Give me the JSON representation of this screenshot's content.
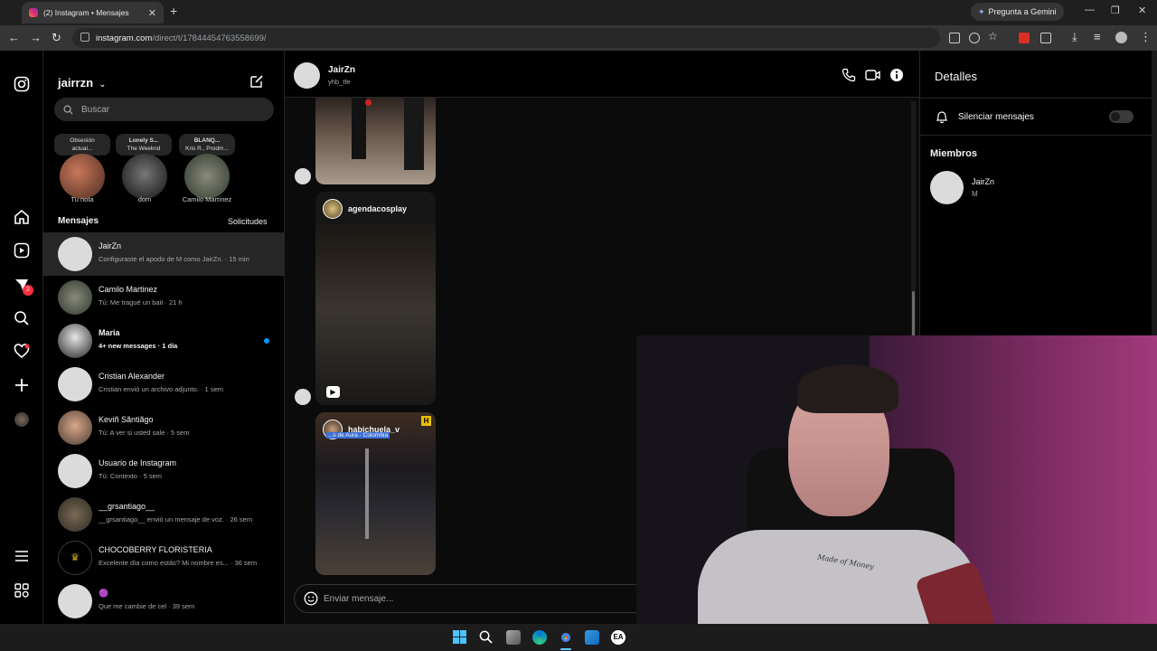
{
  "browser": {
    "tab_title": "(2) Instagram • Mensajes",
    "new_tab": "+",
    "gemini_label": "Pregunta a Gemini",
    "url_host": "instagram.com",
    "url_path": "/direct/t/17844454763558699/"
  },
  "app": {
    "username": "jairrzn",
    "search_placeholder": "Buscar",
    "notes": [
      {
        "line1": "Obsesión",
        "line2": "actual..."
      },
      {
        "line1": "Lonely S...",
        "line2": "The Weeknd"
      },
      {
        "line1": "BLANQ...",
        "line2": "Kris R., Prodm..."
      }
    ],
    "stories": [
      {
        "label": "Tu nota"
      },
      {
        "label": "dom"
      },
      {
        "label": "Camilo Martínez"
      }
    ],
    "section_title": "Mensajes",
    "requests_label": "Solicitudes",
    "rail_badge": "2",
    "conversations": [
      {
        "name": "JairZn",
        "preview": "Configuraste el apodo de M como JairZn. · 15 min",
        "active": true
      },
      {
        "name": "Camilo Martinez",
        "preview": "Tú: Me tragué un bait · 21 h"
      },
      {
        "name": "Maria",
        "preview": "4+ new messages · 1 día",
        "unread": true
      },
      {
        "name": "Cristian Alexander",
        "preview": "Cristian envió un archivo adjunto. · 1 sem"
      },
      {
        "name": "Keviñ Sãntiãgo",
        "preview": "Tú: A ver si usted sale · 5 sem"
      },
      {
        "name": "Usuario de Instagram",
        "preview": "Tú: Contexto · 5 sem"
      },
      {
        "name": "__grsantiago__",
        "preview": "__grsantiago__ envió un mensaje de voz. · 26 sem"
      },
      {
        "name": "CHOCOBERRY FLORISTERIA",
        "preview": "Excelente día como estás? Mi nombre es... · 36 sem"
      },
      {
        "name": "🟣",
        "preview": "Que me cambie de cel · 39 sem"
      }
    ]
  },
  "chat": {
    "name": "JairZn",
    "handle": "yhb_tfe",
    "posts": [
      {
        "author": "agendacosplay"
      },
      {
        "author": "habichuela_v",
        "location": "...s de Aura - Colombia"
      }
    ],
    "composer_placeholder": "Enviar mensaje..."
  },
  "details": {
    "title": "Detalles",
    "mute_label": "Silenciar mensajes",
    "members_title": "Miembros",
    "member_name": "JairZn",
    "member_nick": "M"
  },
  "webcam": {
    "shirt_text": "Made of Money"
  },
  "colors": {
    "ig_bg": "#000000",
    "unread_blue": "#0095f6",
    "badge_red": "#ff3040"
  }
}
